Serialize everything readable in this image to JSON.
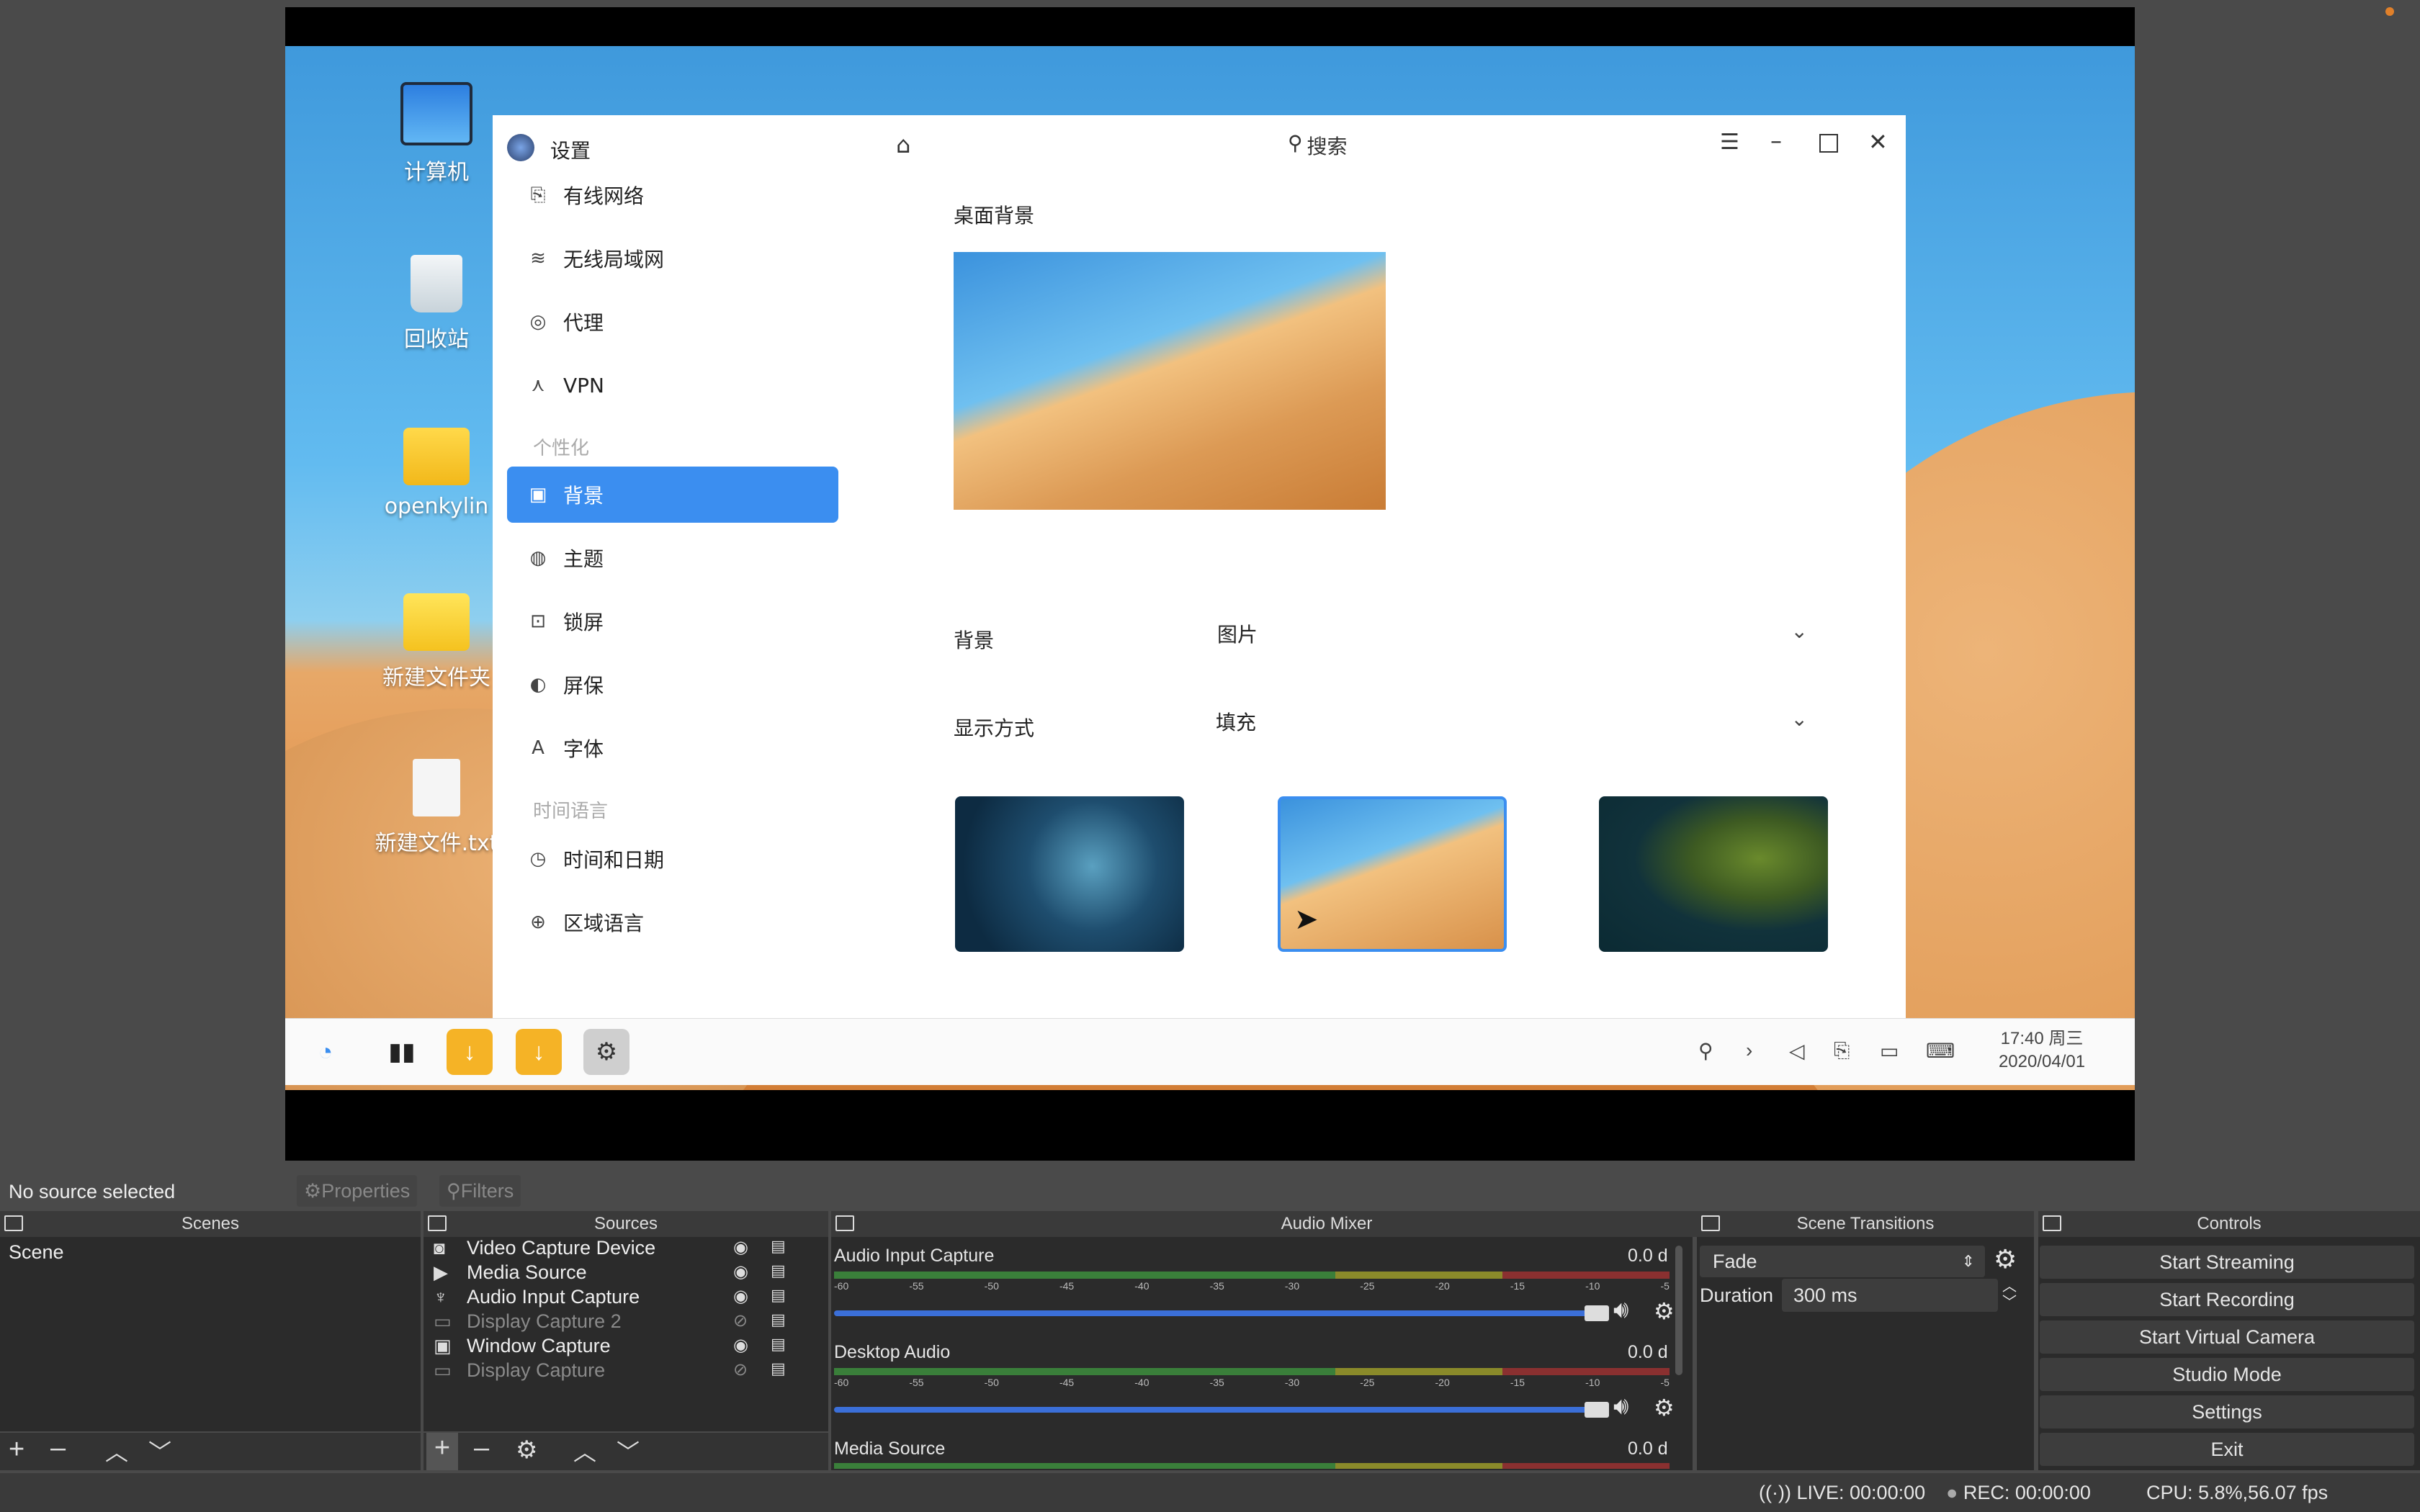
{
  "desktop": {
    "icons": [
      {
        "label": "计算机"
      },
      {
        "label": "回收站"
      },
      {
        "label": "openkylin"
      },
      {
        "label": "新建文件夹"
      },
      {
        "label": "新建文件.txt"
      }
    ]
  },
  "settings": {
    "title": "设置",
    "search_placeholder": "搜索",
    "sidebar": {
      "items": [
        {
          "label": "有线网络",
          "icon": "wired-network-icon"
        },
        {
          "label": "无线局域网",
          "icon": "wifi-icon"
        },
        {
          "label": "代理",
          "icon": "proxy-icon"
        },
        {
          "label": "VPN",
          "icon": "vpn-icon"
        }
      ],
      "section_personal": "个性化",
      "personal_items": [
        {
          "label": "背景",
          "icon": "background-icon",
          "active": true
        },
        {
          "label": "主题",
          "icon": "theme-icon"
        },
        {
          "label": "锁屏",
          "icon": "lockscreen-icon"
        },
        {
          "label": "屏保",
          "icon": "screensaver-icon"
        },
        {
          "label": "字体",
          "icon": "font-icon"
        }
      ],
      "section_time": "时间语言",
      "time_items": [
        {
          "label": "时间和日期",
          "icon": "clock-icon"
        },
        {
          "label": "区域语言",
          "icon": "region-icon"
        }
      ]
    },
    "main": {
      "heading": "桌面背景",
      "background_label": "背景",
      "background_value": "图片",
      "display_label": "显示方式",
      "display_value": "填充"
    }
  },
  "taskbar": {
    "time": "17:40 周三",
    "date": "2020/04/01"
  },
  "obs": {
    "status_no_source": "No source selected",
    "properties": "Properties",
    "filters": "Filters",
    "scenes_title": "Scenes",
    "scene_name": "Scene",
    "sources_title": "Sources",
    "sources": [
      {
        "name": "Video Capture Device",
        "visible": true
      },
      {
        "name": "Media Source",
        "visible": true
      },
      {
        "name": "Audio Input Capture",
        "visible": true
      },
      {
        "name": "Display Capture 2",
        "visible": false
      },
      {
        "name": "Window Capture",
        "visible": true
      },
      {
        "name": "Display Capture",
        "visible": false
      }
    ],
    "mixer_title": "Audio Mixer",
    "channels": [
      {
        "name": "Audio Input Capture",
        "db": "0.0 d"
      },
      {
        "name": "Desktop Audio",
        "db": "0.0 d"
      },
      {
        "name": "Media Source",
        "db": "0.0 d"
      }
    ],
    "ticks": [
      "-60",
      "-55",
      "-50",
      "-45",
      "-40",
      "-35",
      "-30",
      "-25",
      "-20",
      "-15",
      "-10",
      "-5"
    ],
    "transitions_title": "Scene Transitions",
    "transition": "Fade",
    "duration_label": "Duration",
    "duration_value": "300 ms",
    "controls_title": "Controls",
    "controls": [
      "Start Streaming",
      "Start Recording",
      "Start Virtual Camera",
      "Studio Mode",
      "Settings",
      "Exit"
    ],
    "status_live": "LIVE: 00:00:00",
    "status_rec": "REC: 00:00:00",
    "status_cpu": "CPU: 5.8%,56.07 fps"
  }
}
